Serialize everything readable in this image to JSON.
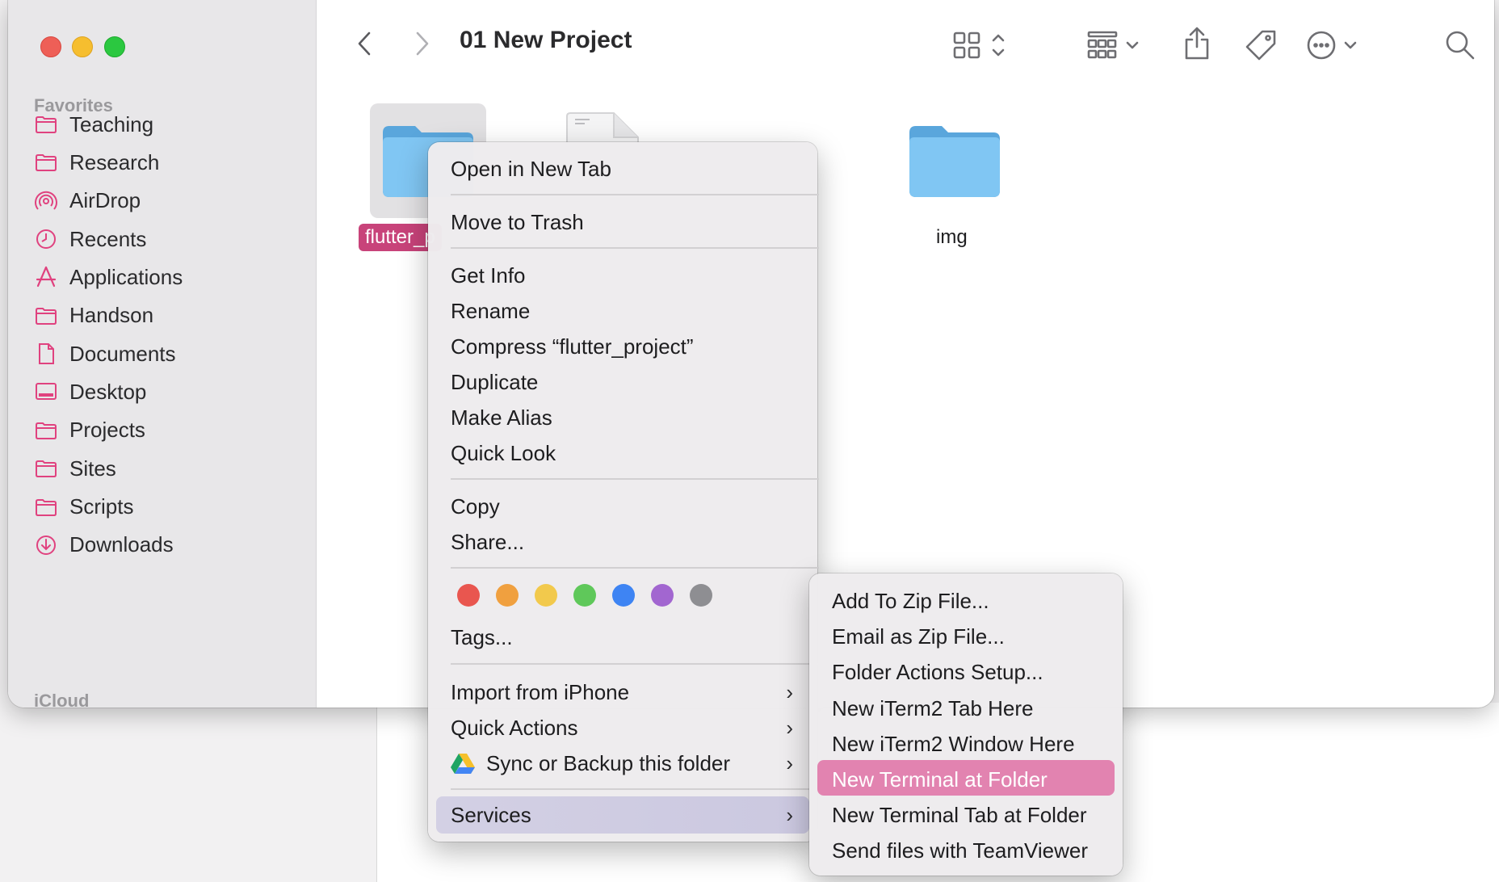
{
  "window": {
    "title": "01 New Project"
  },
  "sidebar": {
    "favorites_label": "Favorites",
    "icloud_label": "iCloud",
    "items": [
      {
        "label": "Teaching",
        "icon": "folder-icon"
      },
      {
        "label": "Research",
        "icon": "folder-icon"
      },
      {
        "label": "AirDrop",
        "icon": "airdrop-icon"
      },
      {
        "label": "Recents",
        "icon": "clock-icon"
      },
      {
        "label": "Applications",
        "icon": "applications-icon"
      },
      {
        "label": "Handson",
        "icon": "folder-icon"
      },
      {
        "label": "Documents",
        "icon": "document-icon"
      },
      {
        "label": "Desktop",
        "icon": "desktop-icon"
      },
      {
        "label": "Projects",
        "icon": "folder-icon"
      },
      {
        "label": "Sites",
        "icon": "folder-icon"
      },
      {
        "label": "Scripts",
        "icon": "folder-icon"
      },
      {
        "label": "Downloads",
        "icon": "download-icon"
      }
    ]
  },
  "files": {
    "selected_name": "flutter_p",
    "img_name": "img"
  },
  "context_menu": {
    "open_new_tab": "Open in New Tab",
    "move_to_trash": "Move to Trash",
    "get_info": "Get Info",
    "rename": "Rename",
    "compress": "Compress “flutter_project”",
    "duplicate": "Duplicate",
    "make_alias": "Make Alias",
    "quick_look": "Quick Look",
    "copy": "Copy",
    "share": "Share...",
    "tags": "Tags...",
    "import_iphone": "Import from iPhone",
    "quick_actions": "Quick Actions",
    "sync_backup": "Sync or Backup this folder",
    "services": "Services",
    "chevron": "›",
    "tag_colors": [
      "#e9564f",
      "#f0a03f",
      "#f2c94c",
      "#5fc85a",
      "#3e84f3",
      "#a266d0",
      "#8e8e92"
    ]
  },
  "services_submenu": {
    "items": [
      "Add To Zip File...",
      "Email as Zip File...",
      "Folder Actions Setup...",
      "New iTerm2 Tab Here",
      "New iTerm2 Window Here",
      "New Terminal at Folder",
      "New Terminal Tab at Folder",
      "Send files with TeamViewer"
    ],
    "highlighted_index": 5
  },
  "colors": {
    "accent_pink": "#e0427f",
    "selection_pink": "#c8437a",
    "folder_blue": "#7fc4f0"
  }
}
